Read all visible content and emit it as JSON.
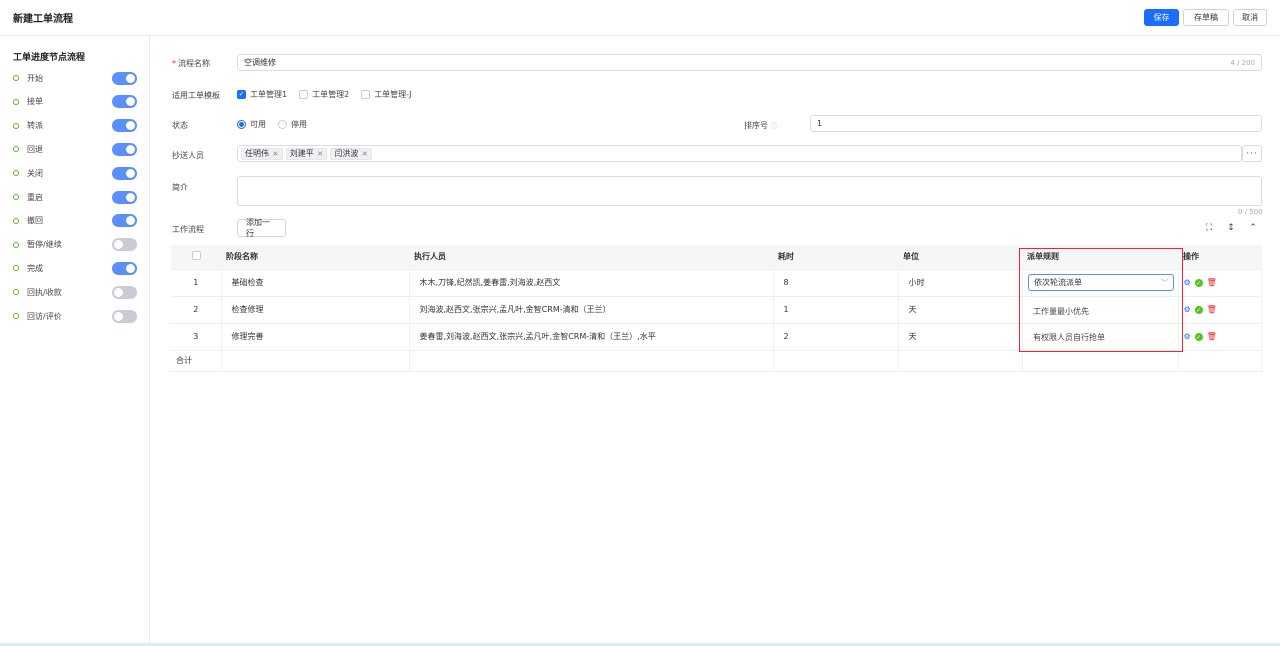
{
  "header": {
    "title": "新建工单流程",
    "save_label": "保存",
    "draft_label": "存草稿",
    "cancel_label": "取消"
  },
  "sidebar": {
    "title": "工单进度节点流程",
    "nodes": [
      {
        "label": "开始",
        "enabled": true
      },
      {
        "label": "接单",
        "enabled": true
      },
      {
        "label": "转派",
        "enabled": true
      },
      {
        "label": "回退",
        "enabled": true
      },
      {
        "label": "关闭",
        "enabled": true
      },
      {
        "label": "重启",
        "enabled": true
      },
      {
        "label": "撤回",
        "enabled": true
      },
      {
        "label": "暂停/继续",
        "enabled": false
      },
      {
        "label": "完成",
        "enabled": true
      },
      {
        "label": "回执/收款",
        "enabled": false
      },
      {
        "label": "回访/评价",
        "enabled": false
      }
    ]
  },
  "form": {
    "name_label": "流程名称",
    "name_required_mark": "*",
    "name_value": "空调维修",
    "name_counter": "4 / 200",
    "template_label": "适用工单模板",
    "templates": [
      {
        "label": "工单管理1",
        "checked": true
      },
      {
        "label": "工单管理2",
        "checked": false
      },
      {
        "label": "工单管理-J",
        "checked": false
      }
    ],
    "status_label": "状态",
    "status_options": [
      {
        "label": "可用",
        "checked": true
      },
      {
        "label": "停用",
        "checked": false
      }
    ],
    "sort_label": "排序号",
    "sort_help_icon": "ⓘ",
    "sort_value": "1",
    "cc_label": "抄送人员",
    "cc_tags": [
      "任明伟",
      "刘建平",
      "闫洪波"
    ],
    "cc_more": "···",
    "intro_label": "简介",
    "intro_value": "",
    "intro_counter": "0 / 500",
    "workflow_label": "工作流程",
    "add_row_label": "添加一行"
  },
  "table": {
    "headers": {
      "stage": "阶段名称",
      "executor": "执行人员",
      "duration": "耗时",
      "unit": "单位",
      "rule": "派单规则",
      "ops": "操作"
    },
    "rows": [
      {
        "index": "1",
        "stage": "基础检查",
        "executor": "木木,刀锋,纪然凯,姜春雷,刘海波,赵西文",
        "duration": "8",
        "unit": "小时"
      },
      {
        "index": "2",
        "stage": "检查修理",
        "executor": "刘海波,赵西文,张宗兴,孟凡叶,金智CRM-清和（王兰）",
        "duration": "1",
        "unit": "天"
      },
      {
        "index": "3",
        "stage": "修理完善",
        "executor": "姜春雷,刘海波,赵西文,张宗兴,孟凡叶,金智CRM-清和（王兰）,水平",
        "duration": "2",
        "unit": "天"
      }
    ],
    "total_label": "合计"
  },
  "rule_dropdown": {
    "selected": "依次轮流派单",
    "options": [
      "工作量最小优先",
      "有权限人员自行抢单"
    ]
  },
  "colors": {
    "primary": "#1a6dff",
    "toggle_on": "#5b8ff9",
    "highlight": "#f5222d",
    "node_dot": "#52c41a"
  }
}
